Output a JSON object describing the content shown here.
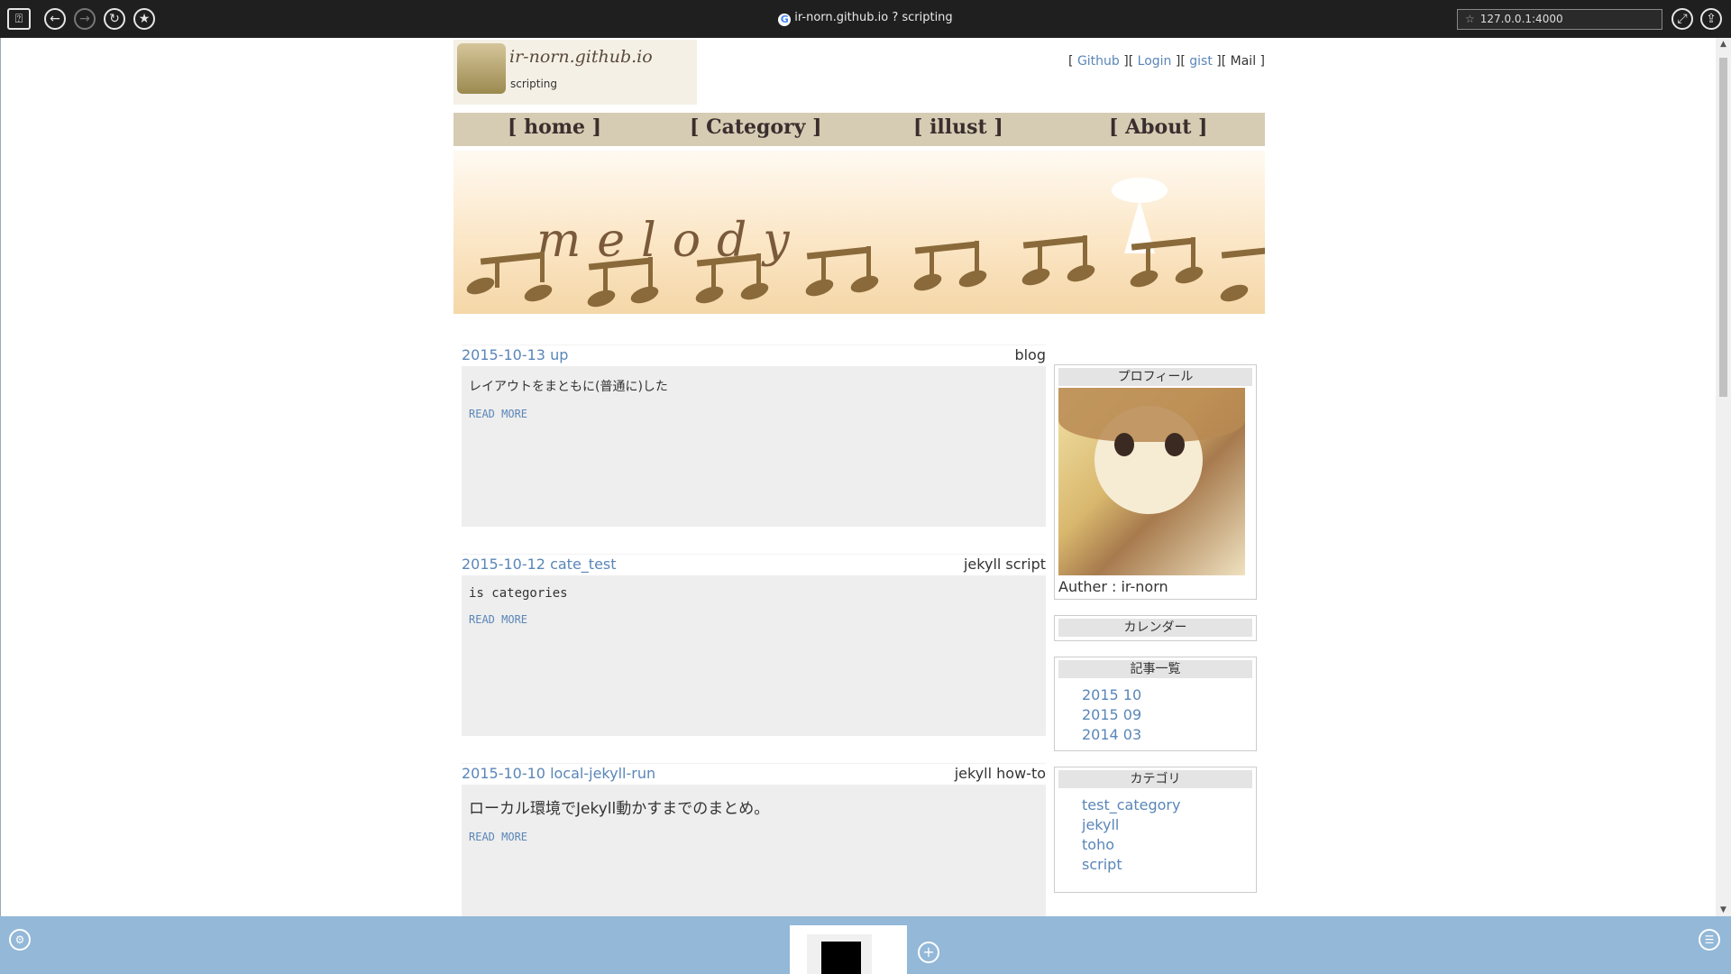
{
  "browser": {
    "tab_title": "ir-norn.github.io ? scripting",
    "address": "127.0.0.1:4000",
    "buttons": {
      "back": "←",
      "forward": "→",
      "reload": "↻",
      "bookmark": "★",
      "fullscreen": "⤢",
      "share": "⇪",
      "app": "⍰"
    }
  },
  "site": {
    "logo_title": "ir-norn.github.io",
    "logo_subtitle": "scripting",
    "toplinks": {
      "github": "Github",
      "login": "Login",
      "gist": "gist",
      "mail": "Mail"
    },
    "nav": [
      {
        "label": "[  home  ]"
      },
      {
        "label": "[  Category  ]"
      },
      {
        "label": "[  illust  ]"
      },
      {
        "label": "[  About  ]"
      }
    ],
    "banner_text": "melody"
  },
  "posts": [
    {
      "title": "2015-10-13 up",
      "category": "blog",
      "excerpt": "レイアウトをまともに(普通に)した",
      "read_more": "READ MORE"
    },
    {
      "title": "2015-10-12 cate_test",
      "category": "jekyll script",
      "excerpt": "is categories",
      "read_more": "READ MORE"
    },
    {
      "title": "2015-10-10 local-jekyll-run",
      "category": "jekyll how-to",
      "excerpt": "ローカル環境でJekyll動かすまでのまとめ。",
      "read_more": "READ MORE"
    }
  ],
  "sidebar": {
    "profile": {
      "title": "プロフィール",
      "author": "Auther : ir-norn"
    },
    "calendar": {
      "title": "カレンダー"
    },
    "archive": {
      "title": "記事一覧",
      "items": [
        "2015 10",
        "2015 09",
        "2014 03"
      ]
    },
    "categories": {
      "title": "カテゴリ",
      "items": [
        "test_category",
        "jekyll",
        "toho",
        "script"
      ]
    }
  },
  "bottombar": {
    "new_tab": "+",
    "left_icon": "⚙",
    "right_icon": "☰"
  }
}
